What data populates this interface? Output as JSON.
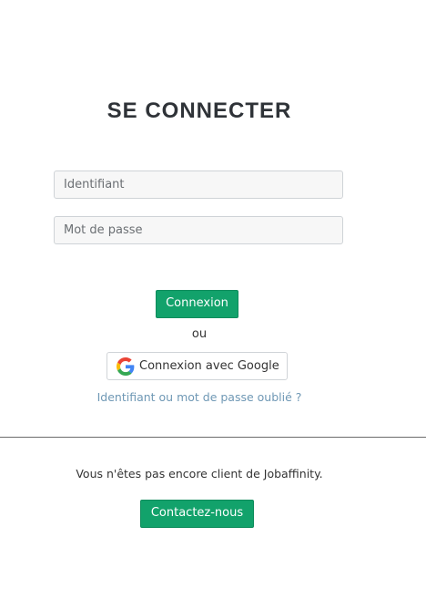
{
  "login": {
    "title": "SE CONNECTER",
    "username_placeholder": "Identifiant",
    "password_placeholder": "Mot de passe",
    "submit_label": "Connexion",
    "or_label": "ou",
    "google_label": "Connexion avec Google",
    "forgot_label": "Identifiant ou mot de passe oublié ?"
  },
  "signup": {
    "message": "Vous n'êtes pas encore client de Jobaffinity.",
    "contact_label": "Contactez-nous"
  },
  "icons": {
    "google": "google-g-icon"
  },
  "colors": {
    "primary_green": "#12a26b",
    "link_blue": "#6f98b5",
    "title": "#2f3338"
  }
}
